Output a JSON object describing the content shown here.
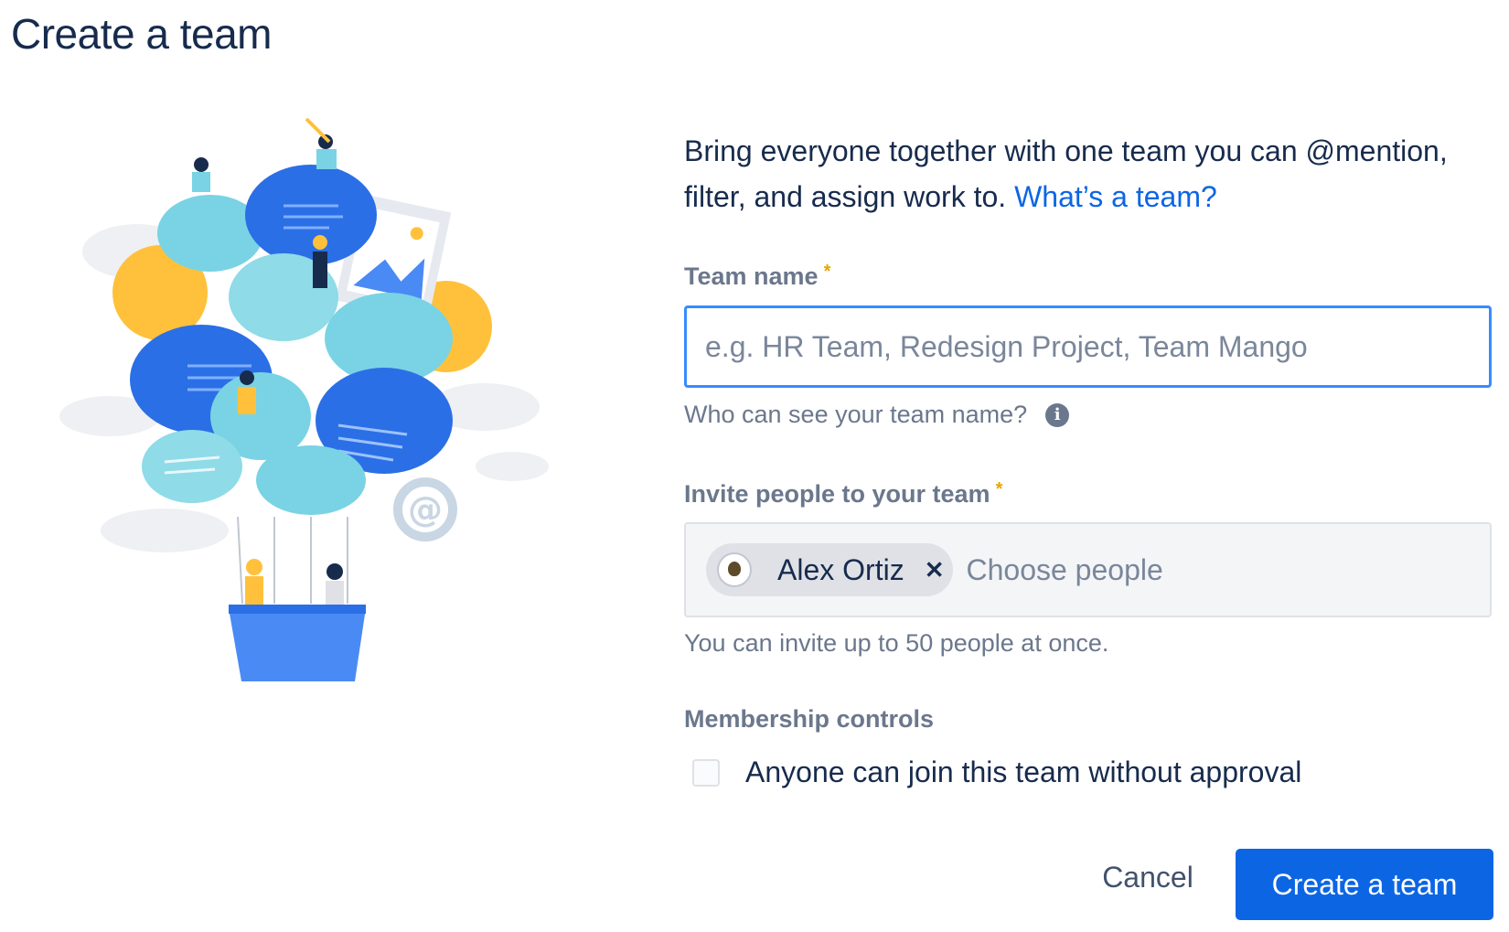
{
  "page": {
    "title": "Create a team"
  },
  "intro": {
    "text": "Bring everyone together with one team you can @mention, filter, and assign work to.",
    "link": "What’s a team?"
  },
  "team_name": {
    "label": "Team name",
    "required_marker": "*",
    "placeholder": "e.g. HR Team, Redesign Project, Team Mango",
    "value": "",
    "helper": "Who can see your team name?"
  },
  "invite": {
    "label": "Invite people to your team",
    "required_marker": "*",
    "selected": [
      {
        "name": "Alex Ortiz"
      }
    ],
    "placeholder": "Choose people",
    "helper": "You can invite up to 50 people at once."
  },
  "membership": {
    "label": "Membership controls",
    "checkbox_label": "Anyone can join this team without approval",
    "checked": false
  },
  "actions": {
    "cancel": "Cancel",
    "create": "Create a team"
  },
  "colors": {
    "primary": "#0c66e4",
    "focus_border": "#388bff",
    "required": "#e6a700"
  },
  "icons": {
    "info": "info-icon",
    "remove_chip": "close-icon"
  }
}
